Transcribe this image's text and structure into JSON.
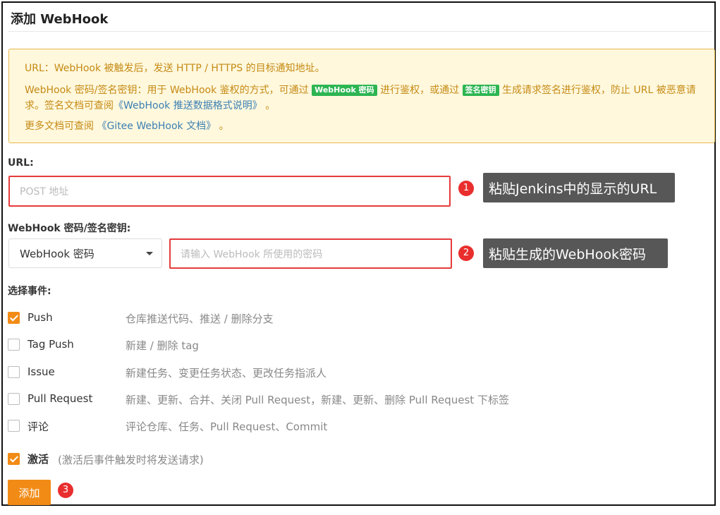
{
  "page": {
    "title": "添加 WebHook"
  },
  "notice": {
    "line1": "URL：WebHook 被触发后，发送 HTTP / HTTPS 的目标通知地址。",
    "line2_a": "WebHook 密码/签名密钥：用于 WebHook 鉴权的方式，可通过",
    "tag_password": "WebHook 密码",
    "line2_b": "进行鉴权，或通过",
    "tag_sign": "签名密钥",
    "line2_c": "生成请求签名进行鉴权，防止 URL 被恶意请求。签名文档可查阅",
    "link_format": "《WebHook 推送数据格式说明》",
    "line2_d": "。",
    "line3_a": "更多文档可查阅",
    "link_docs": "《Gitee WebHook 文档》",
    "line3_b": "。"
  },
  "url": {
    "label": "URL:",
    "placeholder": "POST 地址",
    "badge": "1",
    "callout": "粘贴Jenkins中的显示的URL"
  },
  "secret": {
    "label": "WebHook 密码/签名密钥:",
    "select_value": "WebHook 密码",
    "placeholder": "请输入 WebHook 所使用的密码",
    "badge": "2",
    "callout": "粘贴生成的WebHook密码"
  },
  "events": {
    "label": "选择事件:",
    "items": [
      {
        "name": "Push",
        "desc": "仓库推送代码、推送 / 删除分支",
        "checked": true
      },
      {
        "name": "Tag Push",
        "desc": "新建 / 删除 tag",
        "checked": false
      },
      {
        "name": "Issue",
        "desc": "新建任务、变更任务状态、更改任务指派人",
        "checked": false
      },
      {
        "name": "Pull Request",
        "desc": "新建、更新、合并、关闭 Pull Request，新建、更新、删除 Pull Request 下标签",
        "checked": false
      },
      {
        "name": "评论",
        "desc": "评论仓库、任务、Pull Request、Commit",
        "checked": false
      }
    ]
  },
  "activate": {
    "label": "激活",
    "hint": "(激活后事件触发时将发送请求)",
    "checked": true
  },
  "submit": {
    "label": "添加",
    "badge": "3"
  },
  "colors": {
    "accent": "#f28b16",
    "alert": "#e53b3b",
    "tag_green": "#2db552"
  }
}
